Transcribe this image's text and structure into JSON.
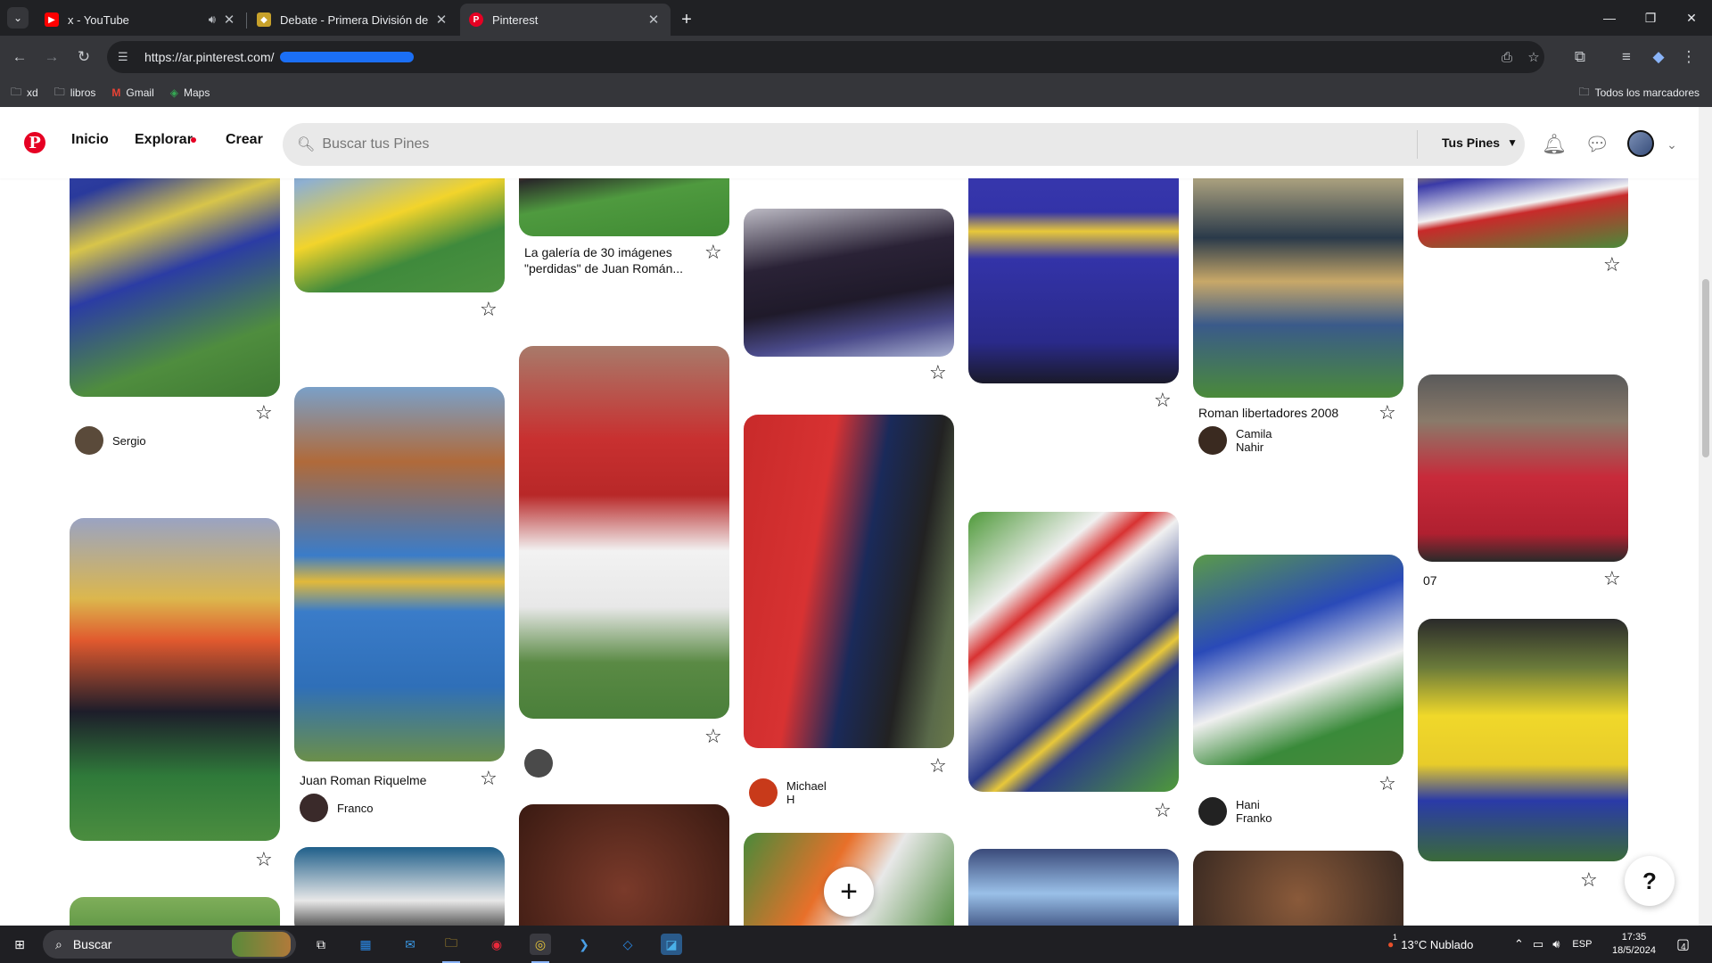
{
  "browser": {
    "tabs": [
      {
        "title": "x - YouTube",
        "favicon_color": "#ff0000",
        "favicon_glyph": "▶",
        "has_audio": true
      },
      {
        "title": "Debate - Primera División de Ar",
        "favicon_color": "#c7a12b",
        "favicon_glyph": "◆",
        "has_audio": false
      },
      {
        "title": "Pinterest",
        "favicon_color": "#e60023",
        "favicon_glyph": "P",
        "has_audio": false,
        "active": true
      }
    ],
    "url": "https://ar.pinterest.com/",
    "bookmarks": [
      {
        "label": "xd",
        "icon": "folder-icon"
      },
      {
        "label": "libros",
        "icon": "folder-icon"
      },
      {
        "label": "Gmail",
        "icon": "gmail-icon"
      },
      {
        "label": "Maps",
        "icon": "maps-icon"
      }
    ],
    "all_bookmarks": "Todos los marcadores"
  },
  "pinterest": {
    "nav": {
      "home": "Inicio",
      "explore": "Explorar",
      "create": "Crear"
    },
    "search_placeholder": "Buscar tus Pines",
    "your_pins": "Tus Pines",
    "brand_color": "#e60023"
  },
  "pins": [
    {
      "col": 0,
      "user": "Sergio",
      "title": ""
    },
    {
      "col": 1,
      "title": "Juan Roman Riquelme",
      "user": "Franco"
    },
    {
      "col": 2,
      "title": "La galería de 30 imágenes \"perdidas\" de Juan Román..."
    },
    {
      "col": 3,
      "user": "Michael H"
    },
    {
      "col": 5,
      "title": "Roman libertadores 2008",
      "user": "Camila Nahir"
    },
    {
      "col": 5,
      "user": "Hani Franko"
    },
    {
      "col": 6,
      "title": "07"
    }
  ],
  "fab": {
    "add": "+",
    "help": "?"
  },
  "taskbar": {
    "search_label": "Buscar",
    "weather": "13°C  Nublado",
    "lang": "ESP",
    "time": "17:35",
    "date": "18/5/2024",
    "notif_count": "4",
    "weather_alert": "1"
  }
}
